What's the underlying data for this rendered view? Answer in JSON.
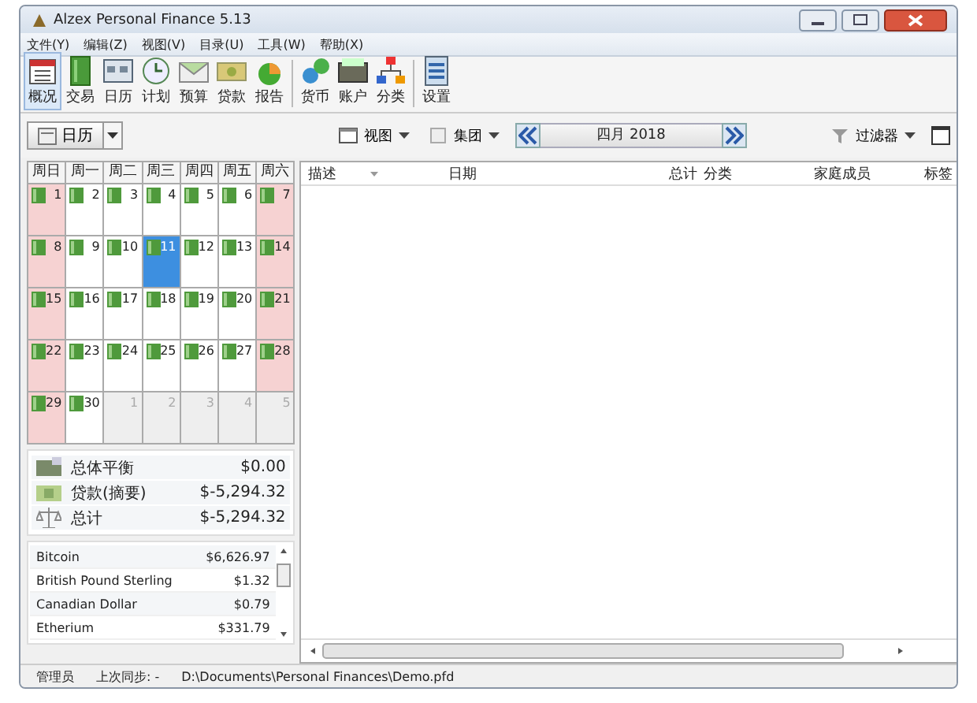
{
  "window": {
    "title": "Alzex Personal Finance 5.13"
  },
  "menu": [
    "文件(Y)",
    "编辑(Z)",
    "视图(V)",
    "目录(U)",
    "工具(W)",
    "帮助(X)"
  ],
  "toolbar": [
    {
      "label": "概况",
      "selected": true
    },
    {
      "label": "交易",
      "selected": false
    },
    {
      "label": "日历",
      "selected": false
    },
    {
      "label": "计划",
      "selected": false
    },
    {
      "label": "预算",
      "selected": false
    },
    {
      "label": "贷款",
      "selected": false
    },
    {
      "label": "报告",
      "selected": false
    },
    {
      "label": "货币",
      "selected": false
    },
    {
      "label": "账户",
      "selected": false
    },
    {
      "label": "分类",
      "selected": false
    },
    {
      "label": "设置",
      "selected": false
    }
  ],
  "view_selector": {
    "label": "日历"
  },
  "view_menu": "视图",
  "group_menu": "集团",
  "period": "四月 2018",
  "filter": "过滤器",
  "columns": [
    "描述",
    "日期",
    "总计",
    "分类",
    "家庭成员",
    "标签"
  ],
  "calendar": {
    "weekdays": [
      "周日",
      "周一",
      "周二",
      "周三",
      "周四",
      "周五",
      "周六"
    ],
    "days": [
      {
        "label": "1",
        "kind": "current",
        "weekend": true,
        "selected": false
      },
      {
        "label": "2",
        "kind": "current",
        "weekend": false,
        "selected": false
      },
      {
        "label": "3",
        "kind": "current",
        "weekend": false,
        "selected": false
      },
      {
        "label": "4",
        "kind": "current",
        "weekend": false,
        "selected": false
      },
      {
        "label": "5",
        "kind": "current",
        "weekend": false,
        "selected": false
      },
      {
        "label": "6",
        "kind": "current",
        "weekend": false,
        "selected": false
      },
      {
        "label": "7",
        "kind": "current",
        "weekend": true,
        "selected": false
      },
      {
        "label": "8",
        "kind": "current",
        "weekend": true,
        "selected": false
      },
      {
        "label": "9",
        "kind": "current",
        "weekend": false,
        "selected": false
      },
      {
        "label": "10",
        "kind": "current",
        "weekend": false,
        "selected": false
      },
      {
        "label": "11",
        "kind": "current",
        "weekend": false,
        "selected": true
      },
      {
        "label": "12",
        "kind": "current",
        "weekend": false,
        "selected": false
      },
      {
        "label": "13",
        "kind": "current",
        "weekend": false,
        "selected": false
      },
      {
        "label": "14",
        "kind": "current",
        "weekend": true,
        "selected": false
      },
      {
        "label": "15",
        "kind": "current",
        "weekend": true,
        "selected": false
      },
      {
        "label": "16",
        "kind": "current",
        "weekend": false,
        "selected": false
      },
      {
        "label": "17",
        "kind": "current",
        "weekend": false,
        "selected": false
      },
      {
        "label": "18",
        "kind": "current",
        "weekend": false,
        "selected": false
      },
      {
        "label": "19",
        "kind": "current",
        "weekend": false,
        "selected": false
      },
      {
        "label": "20",
        "kind": "current",
        "weekend": false,
        "selected": false
      },
      {
        "label": "21",
        "kind": "current",
        "weekend": true,
        "selected": false
      },
      {
        "label": "22",
        "kind": "current",
        "weekend": true,
        "selected": false
      },
      {
        "label": "23",
        "kind": "current",
        "weekend": false,
        "selected": false
      },
      {
        "label": "24",
        "kind": "current",
        "weekend": false,
        "selected": false
      },
      {
        "label": "25",
        "kind": "current",
        "weekend": false,
        "selected": false
      },
      {
        "label": "26",
        "kind": "current",
        "weekend": false,
        "selected": false
      },
      {
        "label": "27",
        "kind": "current",
        "weekend": false,
        "selected": false
      },
      {
        "label": "28",
        "kind": "current",
        "weekend": true,
        "selected": false
      },
      {
        "label": "29",
        "kind": "current",
        "weekend": true,
        "selected": false
      },
      {
        "label": "30",
        "kind": "current",
        "weekend": false,
        "selected": false
      },
      {
        "label": "1",
        "kind": "other",
        "weekend": false,
        "selected": false
      },
      {
        "label": "2",
        "kind": "other",
        "weekend": false,
        "selected": false
      },
      {
        "label": "3",
        "kind": "other",
        "weekend": false,
        "selected": false
      },
      {
        "label": "4",
        "kind": "other",
        "weekend": false,
        "selected": false
      },
      {
        "label": "5",
        "kind": "other",
        "weekend": false,
        "selected": false
      }
    ]
  },
  "summary": [
    {
      "label": "总体平衡",
      "amount": "$0.00"
    },
    {
      "label": "贷款(摘要)",
      "amount": "$-5,294.32"
    },
    {
      "label": "总计",
      "amount": "$-5,294.32"
    }
  ],
  "currencies": [
    {
      "name": "Bitcoin",
      "amount": "$6,626.97"
    },
    {
      "name": "British Pound Sterling",
      "amount": "$1.32"
    },
    {
      "name": "Canadian Dollar",
      "amount": "$0.79"
    },
    {
      "name": "Etherium",
      "amount": "$331.79"
    }
  ],
  "status_bar": [
    "管理员",
    "上次同步: -",
    "D:\\Documents\\Personal Finances\\Demo.pfd"
  ]
}
